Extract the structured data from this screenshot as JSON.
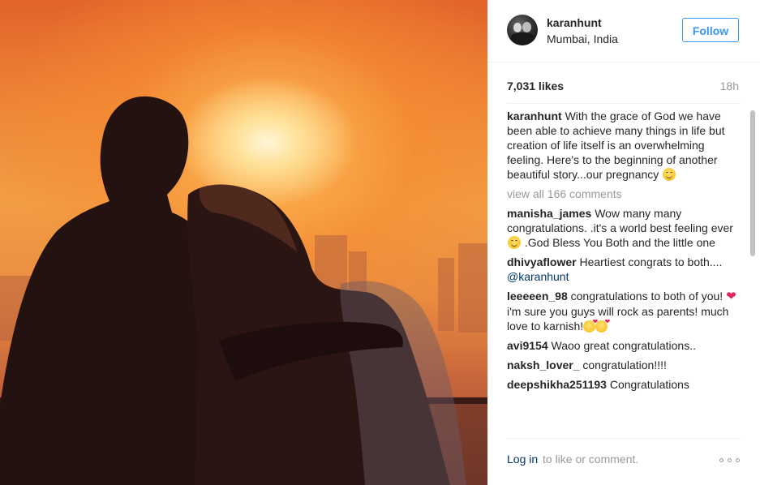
{
  "post": {
    "image_alt": "Couple silhouette at sunset",
    "author": "karanhunt",
    "location": "Mumbai, India",
    "follow_label": "Follow",
    "likes": "7,031 likes",
    "time": "18h",
    "caption_user": "karanhunt",
    "caption_text": "With the grace of God we have been able to achieve many things in life but creation of life itself is an overwhelming feeling. Here's to the beginning of another beautiful story...our pregnancy",
    "view_all": "view all 166 comments"
  },
  "comments": [
    {
      "user": "manisha_james",
      "text_before": "Wow many many congratulations. .it's a world best feeling ever",
      "text_after": ".God Bless You Both and the little one"
    },
    {
      "user": "dhivyaflower",
      "text": "Heartiest congrats to both....",
      "mention": "@karanhunt"
    },
    {
      "user": "leeeeen_98",
      "text_before": "congratulations to both of you!",
      "text_after": "i'm sure you guys will rock as parents! much love to karnish!"
    },
    {
      "user": "avi9154",
      "text": "Waoo great congratulations.."
    },
    {
      "user": "naksh_lover_",
      "text": "congratulation!!!!"
    },
    {
      "user": "deepshikha251193",
      "text": "Congratulations"
    }
  ],
  "footer": {
    "login": "Log in",
    "login_rest": "to like or comment.",
    "more_icon": "more-options-icon"
  },
  "colors": {
    "accent": "#3897f0",
    "link": "#003569",
    "muted": "#999999",
    "text": "#262626",
    "heart": "#e0245e"
  }
}
